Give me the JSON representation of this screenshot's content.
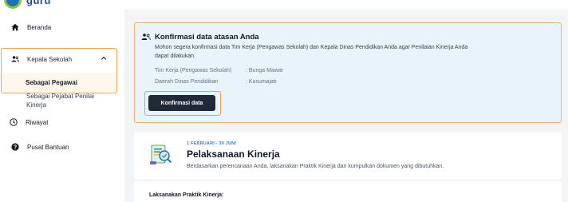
{
  "brand": {
    "logo_text": "guru"
  },
  "sidebar": {
    "home_label": "Beranda",
    "group_label": "Kepala Sekolah",
    "sub_active_label": "Sebagai Pegawai",
    "sub_item_label": "Sebagai Pejabat Penilai Kinerja",
    "history_label": "Riwayat",
    "help_label": "Pusat Bantuan"
  },
  "confirm_card": {
    "title": "Konfirmasi data atasan Anda",
    "description": "Mohon segera konfirmasi data Tim Kerja (Pengawas Sekolah) dan Kepala Dinas Pendidikan Anda agar Penilaian Kinerja Anda dapat dilakukan.",
    "rows": [
      {
        "label": "Tim Kerja (Pengawas Sekolah)",
        "value": ": Bunga Mawar"
      },
      {
        "label": "Daerah Dinas Pendidikan",
        "value": ": Kusumajati"
      }
    ],
    "button_label": "Konfirmasi data"
  },
  "perf_card": {
    "date_range": "1 FEBRUARI - 30 JUNI",
    "title": "Pelaksanaan Kinerja",
    "description": "Berdasarkan perencanaan Anda, laksanakan Praktik Kinerja dan kumpulkan dokumen yang dibutuhkan.",
    "subheading": "Laksanakan Praktik Kinerja:"
  },
  "colors": {
    "accent_orange": "#f0a04b",
    "card_blue": "#e8f3fb",
    "button_dark": "#1f2937",
    "date_blue": "#2f80d1"
  }
}
